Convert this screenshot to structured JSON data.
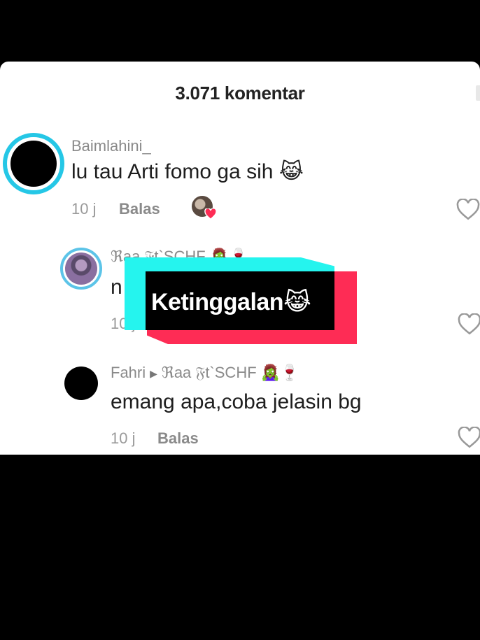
{
  "header": {
    "title": "3.071 komentar"
  },
  "comments": [
    {
      "username": "Baimlahini_",
      "text": "lu tau Arti fomo ga sih",
      "emoji": "😹",
      "time": "10 j",
      "reply_label": "Balas"
    },
    {
      "username": "ℜaa 𝔉t`SCHF 🧟‍♀️🍷",
      "text": "n",
      "time": "10 j"
    },
    {
      "username": "Fahri",
      "reply_to": "ℜaa 𝔉t`SCHF 🧟‍♀️🍷",
      "text": "emang apa,coba jelasin bg",
      "time": "10 j",
      "reply_label": "Balas"
    }
  ],
  "overlay": {
    "text": "Ketinggalan",
    "emoji": "😹"
  },
  "colors": {
    "cyan": "#25f4ee",
    "red": "#fe2c55",
    "ring": "#25c7e6",
    "like": "#fe2c55"
  },
  "icons": [
    "heart-outline-icon",
    "liked-by-creator-icon",
    "reply-arrow-icon"
  ]
}
